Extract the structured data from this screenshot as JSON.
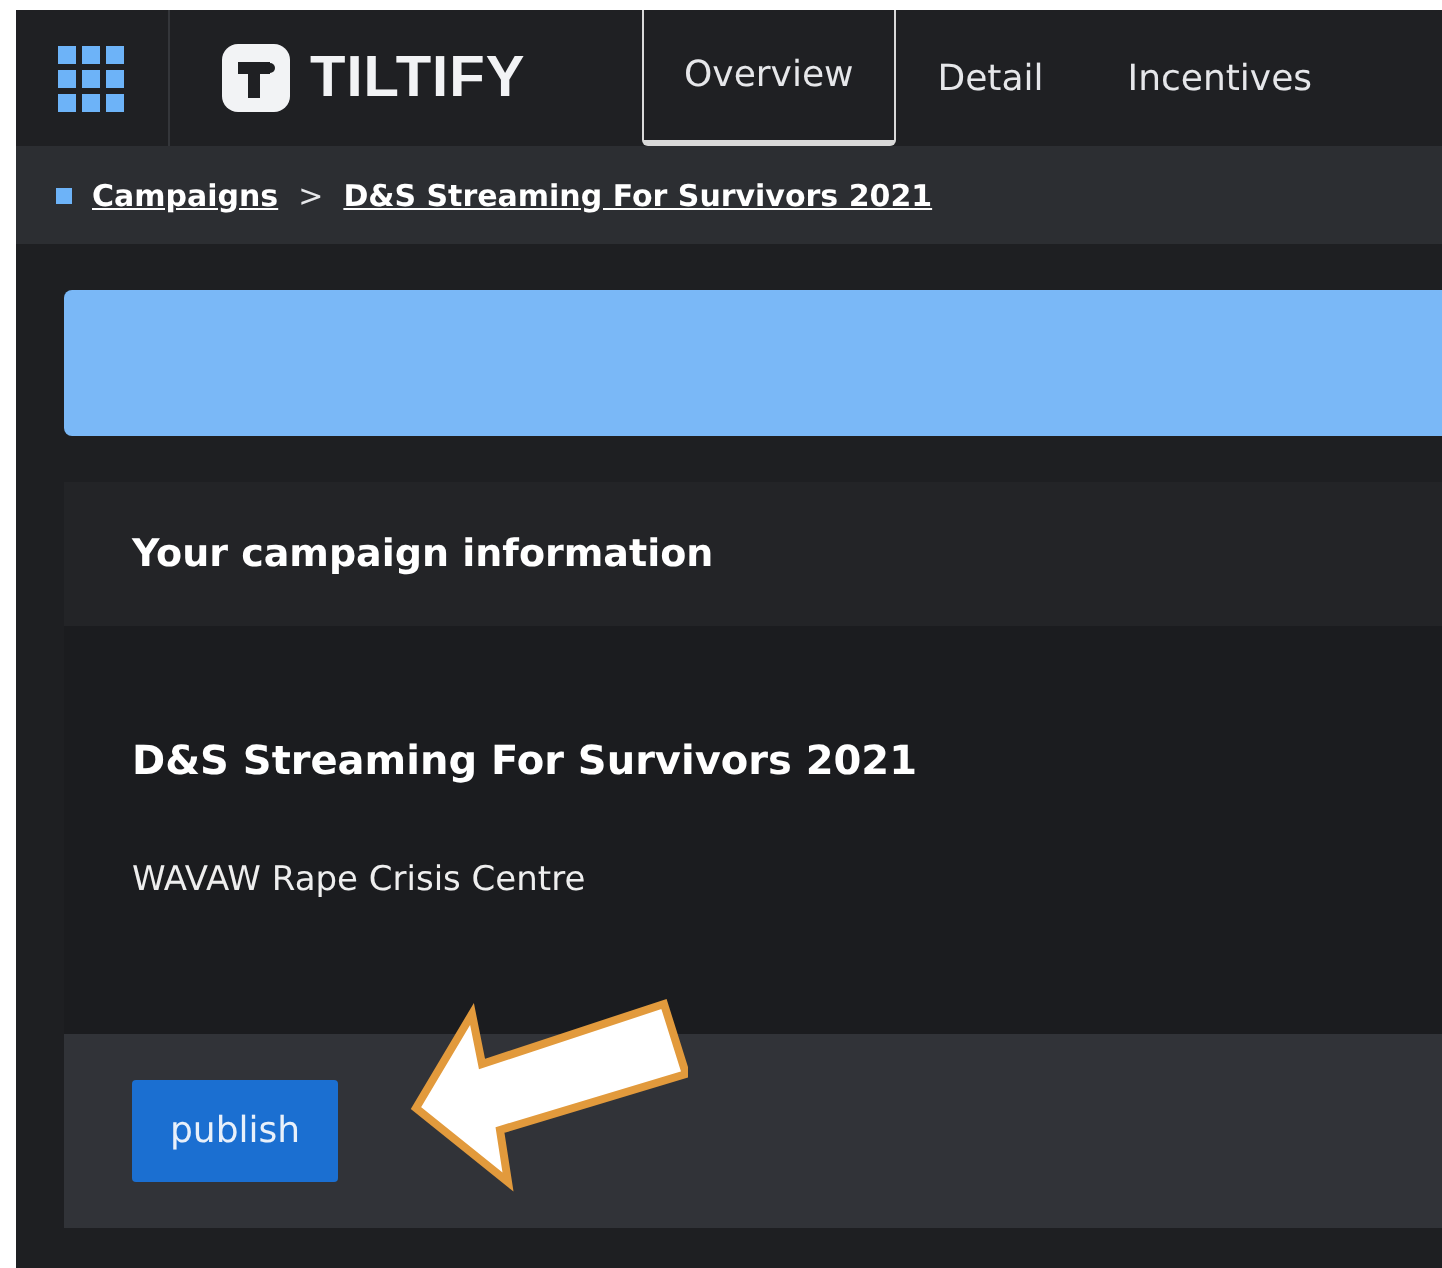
{
  "header": {
    "logo": "TILTIFY",
    "tabs": [
      {
        "label": "Overview",
        "selected": true
      },
      {
        "label": "Detail",
        "selected": false
      },
      {
        "label": "Incentives",
        "selected": false
      }
    ]
  },
  "breadcrumb": {
    "items": [
      {
        "label": "Campaigns"
      },
      {
        "label": "D&S Streaming For Survivors 2021"
      }
    ],
    "separator": ">"
  },
  "card": {
    "title": "Your campaign information",
    "campaign_name": "D&S Streaming For Survivors 2021",
    "cause": "WAVAW Rape Crisis Centre",
    "button": "publish"
  }
}
